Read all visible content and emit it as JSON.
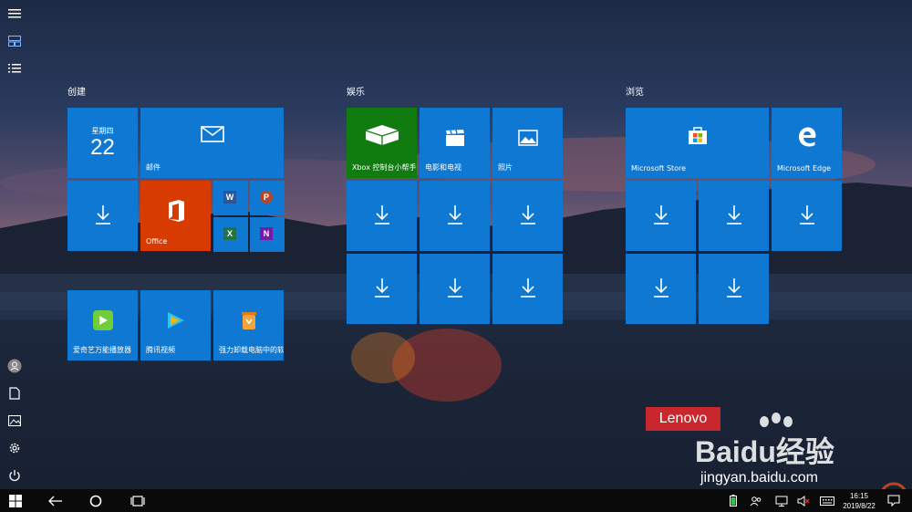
{
  "groups": {
    "create": "创建",
    "entertainment": "娱乐",
    "browse": "浏览"
  },
  "calendar": {
    "weekday": "星期四",
    "day": "22"
  },
  "tiles": {
    "mail": "邮件",
    "office": "Office",
    "xbox": "Xbox 控制台小帮手",
    "movies": "电影和电视",
    "photos": "照片",
    "store": "Microsoft Store",
    "edge": "Microsoft Edge",
    "aiqiyi": "爱奇艺万能播放器",
    "tencent": "腾讯视频",
    "uninstall": "强力卸载电脑中的软件"
  },
  "office_apps": {
    "word": "W",
    "powerpoint": "P",
    "excel": "X",
    "onenote": "N"
  },
  "watermark": {
    "lenovo": "Lenovo",
    "baidu": "Baidu经验",
    "url": "jingyan.baidu.com"
  },
  "taskbar": {
    "time": "16:15",
    "date": "2019/8/22"
  },
  "colors": {
    "tile_blue": "#0f78d3",
    "xbox_green": "#107c10",
    "office_orange": "#d83b01",
    "word_blue": "#2b579a",
    "ppt_red": "#b7472a",
    "excel_green": "#217346",
    "onenote_purple": "#7719aa"
  }
}
